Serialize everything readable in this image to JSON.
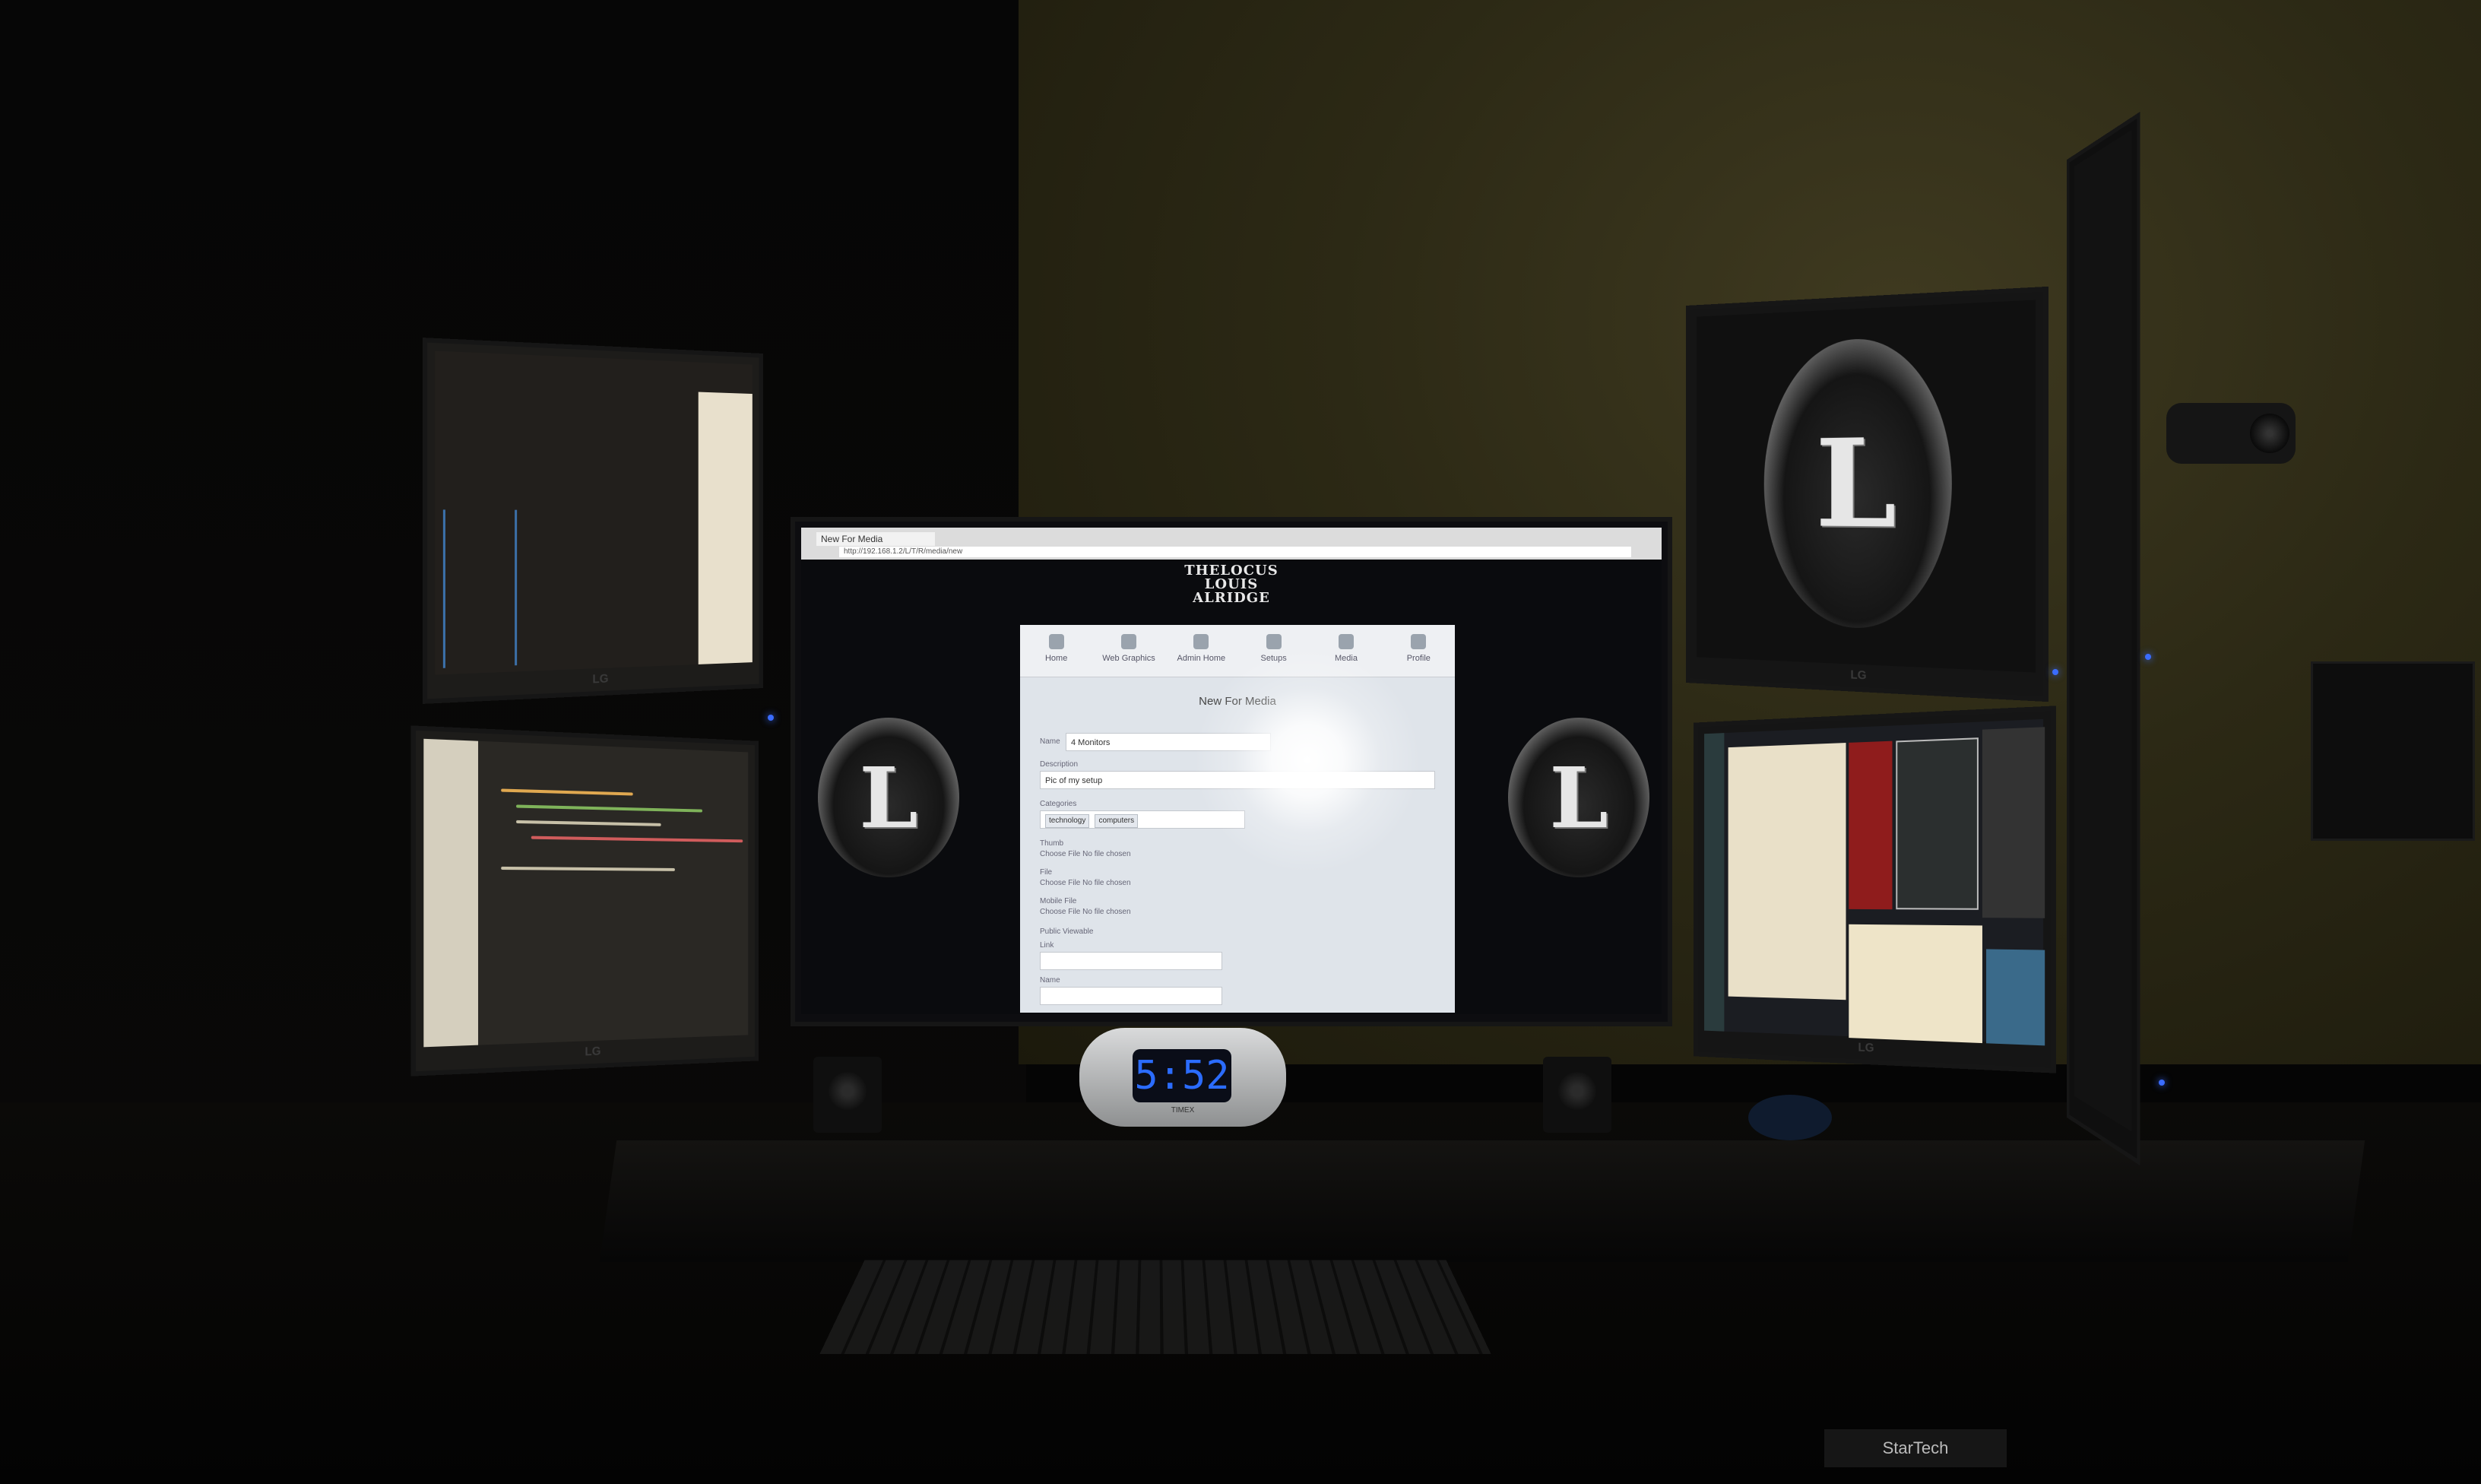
{
  "scene": {
    "brand_label": "LG",
    "colors": {
      "wall": "#2c2915",
      "screen_glow": "#dfe4ea",
      "clock_digits": "#2b6cff"
    }
  },
  "center_browser": {
    "tab_label": "New For Media",
    "url": "http://192.168.1.2/L/T/R/media/new",
    "site_title_lines": [
      "THELOCUS",
      "LOUIS",
      "ALRIDGE"
    ],
    "nav_items": [
      "Home",
      "Web Graphics",
      "Admin Home",
      "Setups",
      "Media",
      "Profile"
    ],
    "nav_icons": [
      "home-icon",
      "eye-icon",
      "admin-icon",
      "book-icon",
      "media-icon",
      "user-icon"
    ],
    "form_title": "New For Media",
    "fields": [
      {
        "label": "Name",
        "value": "4 Monitors"
      },
      {
        "label": "Description",
        "value": "Pic of my setup"
      },
      {
        "label": "Categories",
        "chips": [
          "technology",
          "computers"
        ]
      },
      {
        "label": "Thumb",
        "value": "Choose File  No file chosen"
      },
      {
        "label": "File",
        "value": "Choose File  No file chosen"
      },
      {
        "label": "Mobile File",
        "value": "Choose File  No file chosen"
      },
      {
        "label": "Public Viewable",
        "value": ""
      },
      {
        "label": "Link",
        "value": ""
      },
      {
        "label": "Name",
        "value": ""
      }
    ],
    "logo_letter": "L"
  },
  "right_top_monitor": {
    "logo_letter": "L"
  },
  "clock": {
    "time": "5:52",
    "brand": "TIMEX"
  },
  "startech_label": "StarTech"
}
